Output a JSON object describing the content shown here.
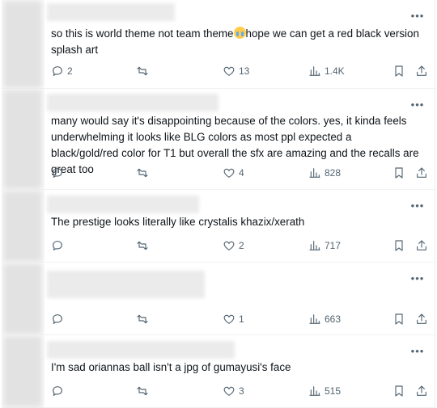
{
  "replies": [
    {
      "text_before": "so this is world theme not team theme",
      "text_after": "hope we can get a red black version splash art",
      "emoji": "loudly-crying-face-emoji",
      "reply_count": "2",
      "retweet_count": "",
      "like_count": "13",
      "view_count": "1.4K"
    },
    {
      "text": "many would say it's disappointing because of the colors. yes, it kinda feels underwhelming it looks like BLG colors as most ppl expected a black/gold/red color for T1 but overall the sfx are amazing and the recalls are great too",
      "reply_count": "",
      "retweet_count": "",
      "like_count": "4",
      "view_count": "828"
    },
    {
      "text": "The prestige looks literally like crystalis khazix/xerath",
      "reply_count": "",
      "retweet_count": "",
      "like_count": "2",
      "view_count": "717"
    },
    {
      "text": "",
      "reply_count": "",
      "retweet_count": "",
      "like_count": "1",
      "view_count": "663"
    },
    {
      "text": "I'm sad oriannas ball isn't a jpg of gumayusi's face",
      "reply_count": "",
      "retweet_count": "",
      "like_count": "3",
      "view_count": "515"
    }
  ],
  "more_label": "•••",
  "icons": [
    "reply-icon",
    "retweet-icon",
    "like-icon",
    "views-icon",
    "bookmark-icon",
    "share-icon",
    "more-icon"
  ],
  "colors": {
    "icon_gray": "#536471",
    "text": "#0f1419",
    "divider": "#eff3f4"
  }
}
